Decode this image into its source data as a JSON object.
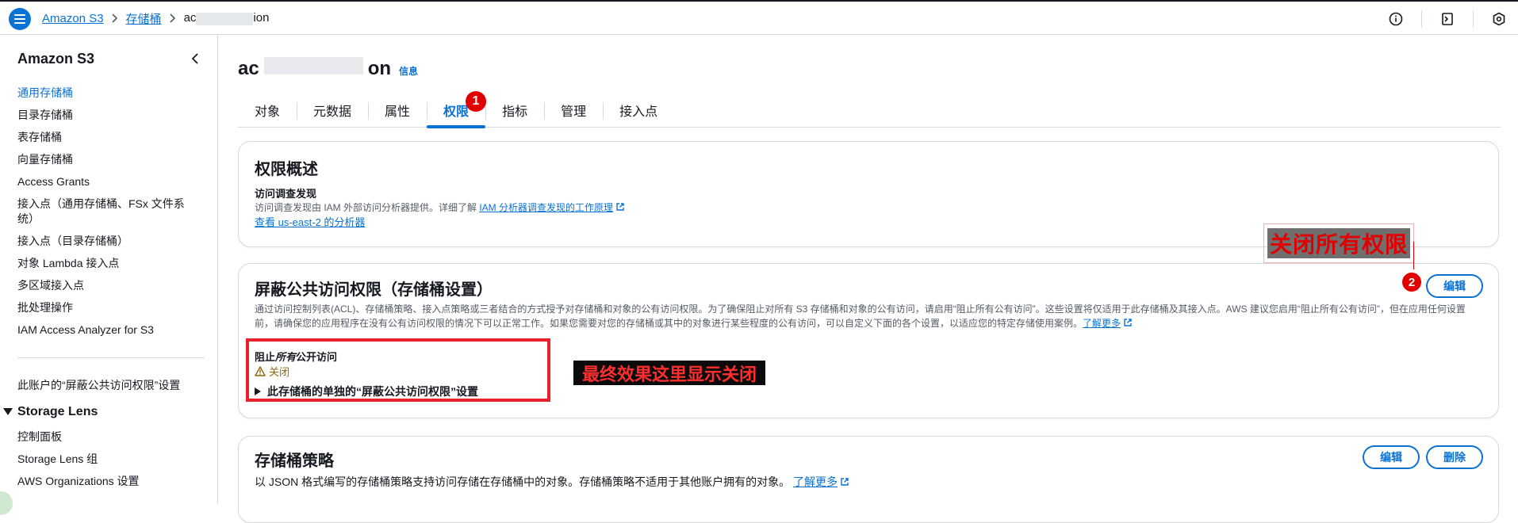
{
  "breadcrumb": {
    "service": "Amazon S3",
    "buckets": "存储桶",
    "current_prefix": "ac",
    "current_suffix": "ion"
  },
  "sidebar": {
    "title": "Amazon S3",
    "items": [
      {
        "label": "通用存储桶",
        "active": true
      },
      {
        "label": "目录存储桶"
      },
      {
        "label": "表存储桶"
      },
      {
        "label": "向量存储桶"
      },
      {
        "label": "Access Grants"
      },
      {
        "label": "接入点（通用存储桶、FSx 文件系统）"
      },
      {
        "label": "接入点（目录存储桶）"
      },
      {
        "label": "对象 Lambda 接入点"
      },
      {
        "label": "多区域接入点"
      },
      {
        "label": "批处理操作"
      },
      {
        "label": "IAM Access Analyzer for S3"
      }
    ],
    "account_setting": "此账户的“屏蔽公共访问权限”设置",
    "storage_lens": {
      "title": "Storage Lens",
      "items": [
        "控制面板",
        "Storage Lens 组",
        "AWS Organizations 设置"
      ]
    }
  },
  "page": {
    "title_prefix": "ac",
    "title_suffix": "on",
    "info": "信息"
  },
  "tabs": [
    "对象",
    "元数据",
    "属性",
    "权限",
    "指标",
    "管理",
    "接入点"
  ],
  "active_tab": "权限",
  "badges": {
    "step1": "1",
    "step2": "2"
  },
  "permissions_overview": {
    "title": "权限概述",
    "subheading": "访问调查发现",
    "desc_prefix": "访问调查发现由 IAM 外部访问分析器提供。详细了解 ",
    "desc_link": "IAM 分析器调查发现的工作原理",
    "analyzer_link": "查看 us-east-2 的分析器"
  },
  "block_public_access": {
    "title": "屏蔽公共访问权限（存储桶设置）",
    "edit_button": "编辑",
    "desc_line1": "通过访问控制列表(ACL)、存储桶策略、接入点策略或三者结合的方式授予对存储桶和对象的公有访问权限。为了确保阻止对所有 S3 存储桶和对象的公有访问，请启用“阻止所有公有访问”。这些设置将仅适用于此存储桶及其接入点。AWS 建议您启用“阻止所有公有访问”，但在应用任何设置",
    "desc_line2_prefix": "前，请确保您的应用程序在没有公有访问权限的情况下可以正常工作。如果您需要对您的存储桶或其中的对象进行某些程度的公有访问，可以自定义下面的各个设置，以适应您的特定存储使用案例。",
    "learn_more": "了解更多",
    "block_all_label_a": "阻止",
    "block_all_label_em": "所有",
    "block_all_label_b": "公开访问",
    "status": "关闭",
    "expander": "此存储桶的单独的“屏蔽公共访问权限”设置"
  },
  "bucket_policy": {
    "title": "存储桶策略",
    "edit_button": "编辑",
    "delete_button": "删除",
    "desc": "以 JSON 格式编写的存储桶策略支持访问存储在存储桶中的对象。存储桶策略不适用于其他账户拥有的对象。",
    "learn_more": "了解更多"
  },
  "annotations": {
    "close_all": "关闭所有权限",
    "final_effect": "最终效果这里显示关闭"
  },
  "colors": {
    "accent": "#0972d3",
    "warning": "#8d6605",
    "annotation_red": "#e00000"
  }
}
